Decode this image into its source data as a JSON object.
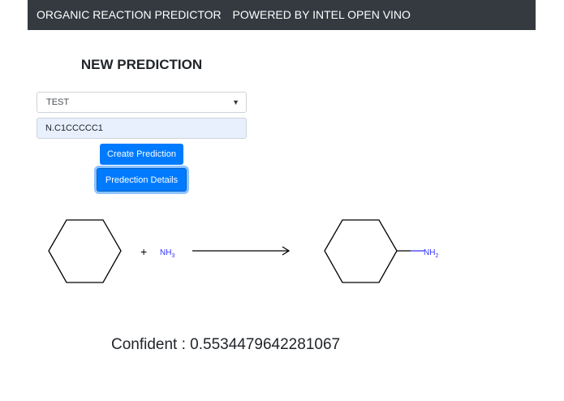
{
  "navbar": {
    "brand": "ORGANIC REACTION PREDICTOR",
    "tagline": "POWERED BY INTEL OPEN VINO"
  },
  "form": {
    "title": "NEW PREDICTION",
    "model_select": {
      "selected": "TEST"
    },
    "smiles_input": {
      "value": "N.C1CCCCC1"
    },
    "create_button": "Create Prediction",
    "details_button": "Predection Details"
  },
  "reaction": {
    "plus": "+",
    "reagent_main": "NH",
    "reagent_sub": "3",
    "product_group_main": "NH",
    "product_group_sub": "2",
    "heteroatom_color": "#3333ff"
  },
  "result": {
    "confidence_text": "Confident : 0.5534479642281067"
  },
  "colors": {
    "navbar_bg": "#343a40",
    "primary": "#007bff"
  }
}
